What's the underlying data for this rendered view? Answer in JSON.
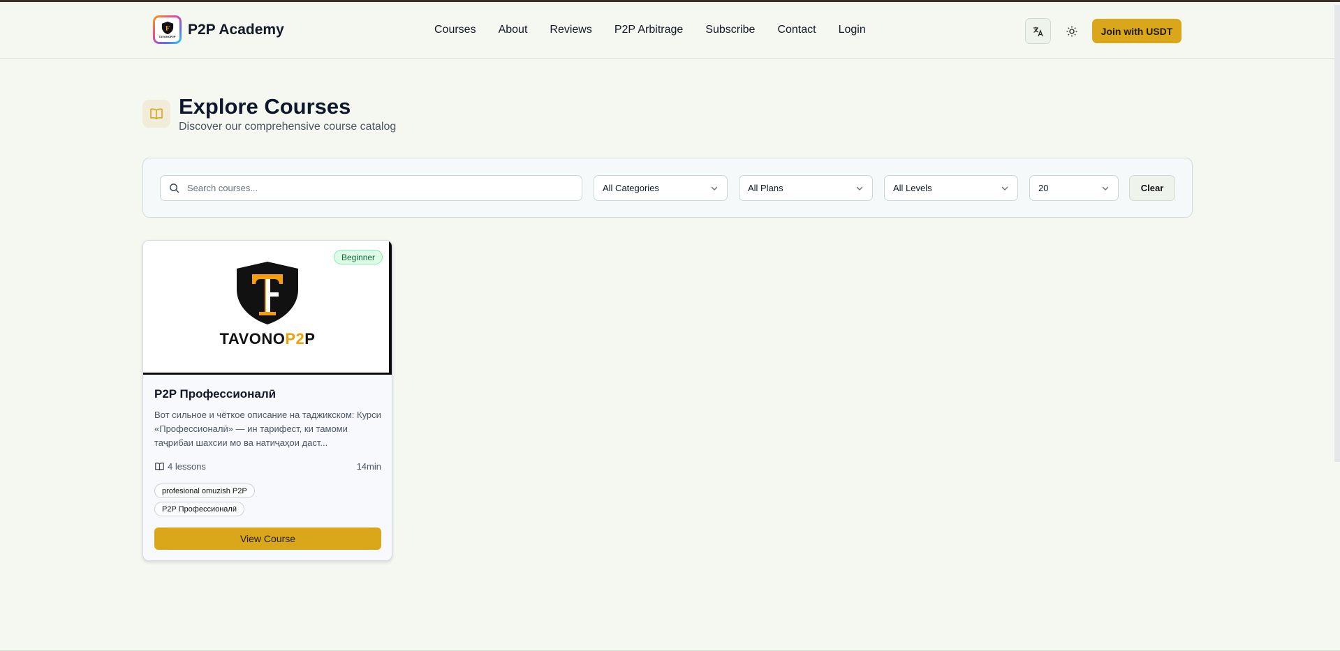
{
  "header": {
    "brand": "P2P Academy",
    "logo_caption": "TAVONOP2P",
    "nav": [
      "Courses",
      "About",
      "Reviews",
      "P2P Arbitrage",
      "Subscribe",
      "Contact",
      "Login"
    ],
    "join_label": "Join with USDT"
  },
  "hero": {
    "title": "Explore Courses",
    "subtitle": "Discover our comprehensive course catalog"
  },
  "filters": {
    "search_placeholder": "Search courses...",
    "category": "All Categories",
    "plan": "All Plans",
    "level": "All Levels",
    "per_page": "20",
    "clear_label": "Clear"
  },
  "courses": [
    {
      "brand_main": "TAVONO",
      "brand_accent": "P2",
      "brand_end": "P",
      "level": "Beginner",
      "title": "P2P Профессионалӣ",
      "description": "Вот сильное и чёткое описание на таджикском: Курси «Профессионалӣ» — ин тарифест, ки тамоми таҷрибаи шахсии мо ва натиҷаҳои даст...",
      "lessons": "4 lessons",
      "duration": "14min",
      "tags": [
        "profesional omuzish P2P",
        "P2P Профессионалӣ"
      ],
      "button": "View Course"
    }
  ],
  "colors": {
    "accent": "#dba71a",
    "background": "#f4f8f1"
  }
}
